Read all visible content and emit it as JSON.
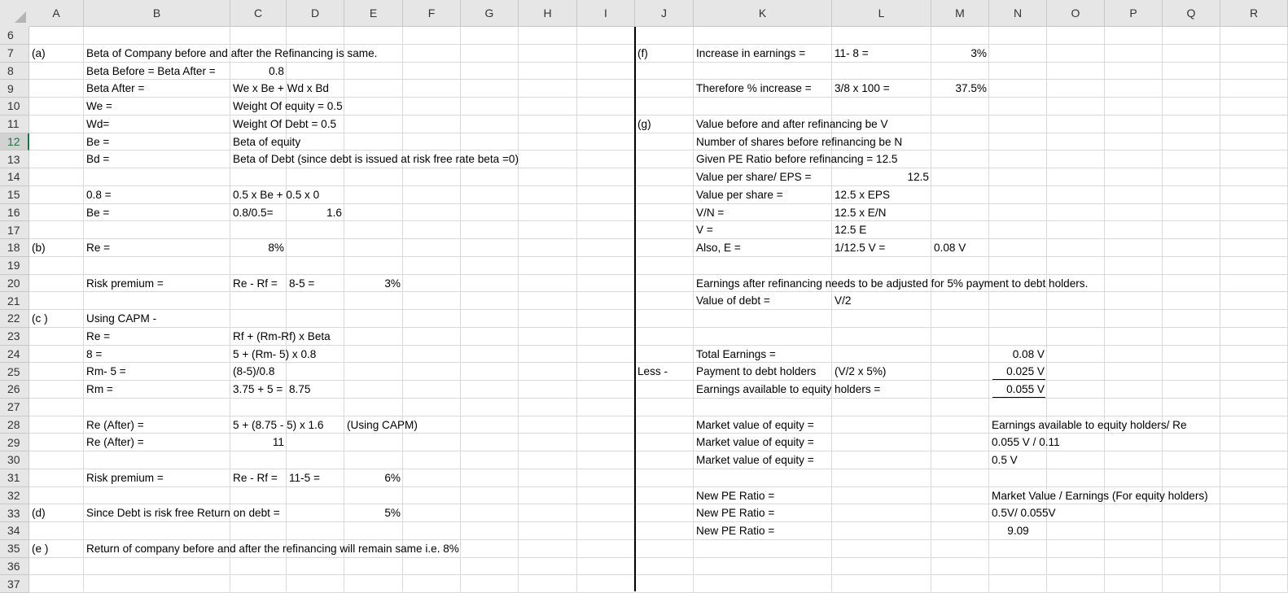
{
  "columns": [
    "A",
    "B",
    "C",
    "D",
    "E",
    "F",
    "G",
    "H",
    "I",
    "J",
    "K",
    "L",
    "M",
    "N",
    "O",
    "P",
    "Q",
    "R"
  ],
  "rows": [
    6,
    7,
    8,
    9,
    10,
    11,
    12,
    13,
    14,
    15,
    16,
    17,
    18,
    19,
    20,
    21,
    22,
    23,
    24,
    25,
    26,
    27,
    28,
    29,
    30,
    31,
    32,
    33,
    34,
    35,
    36,
    37
  ],
  "selected_row": 12,
  "cells": [
    {
      "ref": "A7",
      "text": "(a)"
    },
    {
      "ref": "B7",
      "text": "Beta of Company before and after the Refinancing is same."
    },
    {
      "ref": "J7",
      "text": "(f)"
    },
    {
      "ref": "K7",
      "text": "Increase in earnings ="
    },
    {
      "ref": "L7",
      "text": "11- 8 ="
    },
    {
      "ref": "M7",
      "text": "3%"
    },
    {
      "ref": "B8",
      "text": "Beta Before = Beta After ="
    },
    {
      "ref": "C8",
      "text": "0.8"
    },
    {
      "ref": "B9",
      "text": "Beta After ="
    },
    {
      "ref": "C9",
      "text": "We x Be + Wd x Bd"
    },
    {
      "ref": "K9",
      "text": "Therefore % increase ="
    },
    {
      "ref": "L9",
      "text": "3/8  x 100 ="
    },
    {
      "ref": "M9",
      "text": "37.5%"
    },
    {
      "ref": "B10",
      "text": "We ="
    },
    {
      "ref": "C10",
      "text": "Weight Of equity = 0.5"
    },
    {
      "ref": "B11",
      "text": "Wd="
    },
    {
      "ref": "C11",
      "text": "Weight Of Debt = 0.5"
    },
    {
      "ref": "J11",
      "text": "(g)"
    },
    {
      "ref": "K11",
      "text": "Value before and after refinancing be V"
    },
    {
      "ref": "B12",
      "text": "Be ="
    },
    {
      "ref": "C12",
      "text": "Beta of equity"
    },
    {
      "ref": "K12",
      "text": "Number of shares before refinancing be N"
    },
    {
      "ref": "B13",
      "text": "Bd ="
    },
    {
      "ref": "C13",
      "text": "Beta of Debt (since debt is issued at risk free rate beta =0)"
    },
    {
      "ref": "K13",
      "text": "Given PE Ratio before refinancing = 12.5"
    },
    {
      "ref": "K14",
      "text": "Value per share/ EPS ="
    },
    {
      "ref": "L14",
      "text": "12.5"
    },
    {
      "ref": "B15",
      "text": "0.8 ="
    },
    {
      "ref": "C15",
      "text": "0.5 x Be + 0.5 x 0"
    },
    {
      "ref": "K15",
      "text": "Value per share ="
    },
    {
      "ref": "L15",
      "text": "12.5 x EPS"
    },
    {
      "ref": "B16",
      "text": "Be ="
    },
    {
      "ref": "C16",
      "text": "0.8/0.5="
    },
    {
      "ref": "D16",
      "text": "1.6"
    },
    {
      "ref": "K16",
      "text": "V/N ="
    },
    {
      "ref": "L16",
      "text": "12.5 x E/N"
    },
    {
      "ref": "K17",
      "text": "V ="
    },
    {
      "ref": "L17",
      "text": "12.5 E"
    },
    {
      "ref": "A18",
      "text": "(b)"
    },
    {
      "ref": "B18",
      "text": "Re ="
    },
    {
      "ref": "C18",
      "text": "8%"
    },
    {
      "ref": "K18",
      "text": "Also, E ="
    },
    {
      "ref": "L18",
      "text": "1/12.5 V ="
    },
    {
      "ref": "M18",
      "text": "0.08 V"
    },
    {
      "ref": "B20",
      "text": "Risk premium ="
    },
    {
      "ref": "C20",
      "text": "Re - Rf ="
    },
    {
      "ref": "D20",
      "text": "8-5 ="
    },
    {
      "ref": "E20",
      "text": "3%"
    },
    {
      "ref": "K20",
      "text": "Earnings after refinancing needs to be adjusted for 5% payment to debt holders."
    },
    {
      "ref": "K21",
      "text": "Value of debt ="
    },
    {
      "ref": "L21",
      "text": "V/2"
    },
    {
      "ref": "A22",
      "text": "(c )"
    },
    {
      "ref": "B22",
      "text": "Using CAPM -"
    },
    {
      "ref": "B23",
      "text": "Re ="
    },
    {
      "ref": "C23",
      "text": "Rf + (Rm-Rf) x Beta"
    },
    {
      "ref": "B24",
      "text": "8 ="
    },
    {
      "ref": "C24",
      "text": "5 + (Rm- 5) x 0.8"
    },
    {
      "ref": "K24",
      "text": "Total Earnings ="
    },
    {
      "ref": "N24",
      "text": "0.08 V"
    },
    {
      "ref": "B25",
      "text": "Rm- 5 ="
    },
    {
      "ref": "C25",
      "text": "(8-5)/0.8"
    },
    {
      "ref": "J25",
      "text": "Less -"
    },
    {
      "ref": "K25",
      "text": "Payment to debt holders"
    },
    {
      "ref": "L25",
      "text": "(V/2 x 5%)"
    },
    {
      "ref": "N25",
      "text": "0.025 V"
    },
    {
      "ref": "B26",
      "text": "Rm ="
    },
    {
      "ref": "C26",
      "text": "3.75 + 5 ="
    },
    {
      "ref": "D26",
      "text": "8.75"
    },
    {
      "ref": "K26",
      "text": "Earnings available to equity holders ="
    },
    {
      "ref": "N26",
      "text": "0.055 V"
    },
    {
      "ref": "B28",
      "text": "Re (After) ="
    },
    {
      "ref": "C28",
      "text": "5 + (8.75 - 5) x 1.6"
    },
    {
      "ref": "E28",
      "text": "(Using CAPM)"
    },
    {
      "ref": "K28",
      "text": "Market value of equity ="
    },
    {
      "ref": "N28",
      "text": "Earnings available to equity holders/ Re"
    },
    {
      "ref": "B29",
      "text": "Re (After) ="
    },
    {
      "ref": "C29",
      "text": "11"
    },
    {
      "ref": "K29",
      "text": "Market value of equity ="
    },
    {
      "ref": "N29",
      "text": "0.055 V / 0.11"
    },
    {
      "ref": "K30",
      "text": "Market value of equity ="
    },
    {
      "ref": "N30",
      "text": "0.5 V"
    },
    {
      "ref": "B31",
      "text": "Risk premium ="
    },
    {
      "ref": "C31",
      "text": "Re - Rf ="
    },
    {
      "ref": "D31",
      "text": "11-5 ="
    },
    {
      "ref": "E31",
      "text": "6%"
    },
    {
      "ref": "K32",
      "text": "New PE Ratio ="
    },
    {
      "ref": "N32",
      "text": "Market Value / Earnings (For equity holders)"
    },
    {
      "ref": "A33",
      "text": "(d)"
    },
    {
      "ref": "B33",
      "text": "Since Debt is risk free Return on debt ="
    },
    {
      "ref": "E33",
      "text": "5%"
    },
    {
      "ref": "K33",
      "text": "New PE Ratio ="
    },
    {
      "ref": "N33",
      "text": "0.5V/ 0.055V"
    },
    {
      "ref": "K34",
      "text": "New PE Ratio ="
    },
    {
      "ref": "N34",
      "text": "9.09"
    },
    {
      "ref": "A35",
      "text": "(e )"
    },
    {
      "ref": "B35",
      "text": "Return of company before and after the refinancing will remain same i.e. 8%"
    }
  ]
}
